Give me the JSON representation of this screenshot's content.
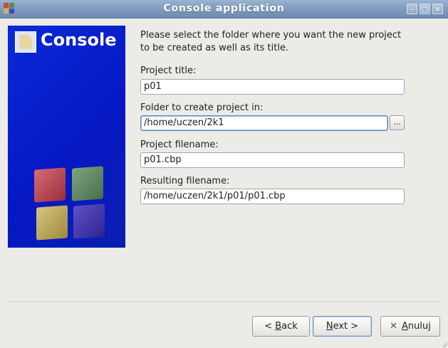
{
  "window": {
    "title": "Console application"
  },
  "banner": {
    "title": "Console"
  },
  "intro": {
    "line1": "Please select the folder where you want the new project",
    "line2": "to be created as well as its title."
  },
  "fields": {
    "project_title": {
      "label": "Project title:",
      "value": "p01"
    },
    "folder": {
      "label": "Folder to create project in:",
      "value": "/home/uczen/2k1",
      "browse_label": "..."
    },
    "project_filename": {
      "label": "Project filename:",
      "value": "p01.cbp"
    },
    "resulting_filename": {
      "label": "Resulting filename:",
      "value": "/home/uczen/2k1/p01/p01.cbp"
    }
  },
  "buttons": {
    "back": {
      "prefix": "< ",
      "accel": "B",
      "rest": "ack"
    },
    "next": {
      "accel": "N",
      "rest": "ext >"
    },
    "cancel": {
      "accel": "A",
      "rest": "nuluj"
    }
  },
  "colors": {
    "banner": "#0618c4",
    "titlebar": "#7f9bbd",
    "focus": "#5e8bc2"
  },
  "icons": [
    "app-icon",
    "minimize-icon",
    "maximize-icon",
    "close-icon",
    "banner-console-icon",
    "cancel-x-icon"
  ]
}
